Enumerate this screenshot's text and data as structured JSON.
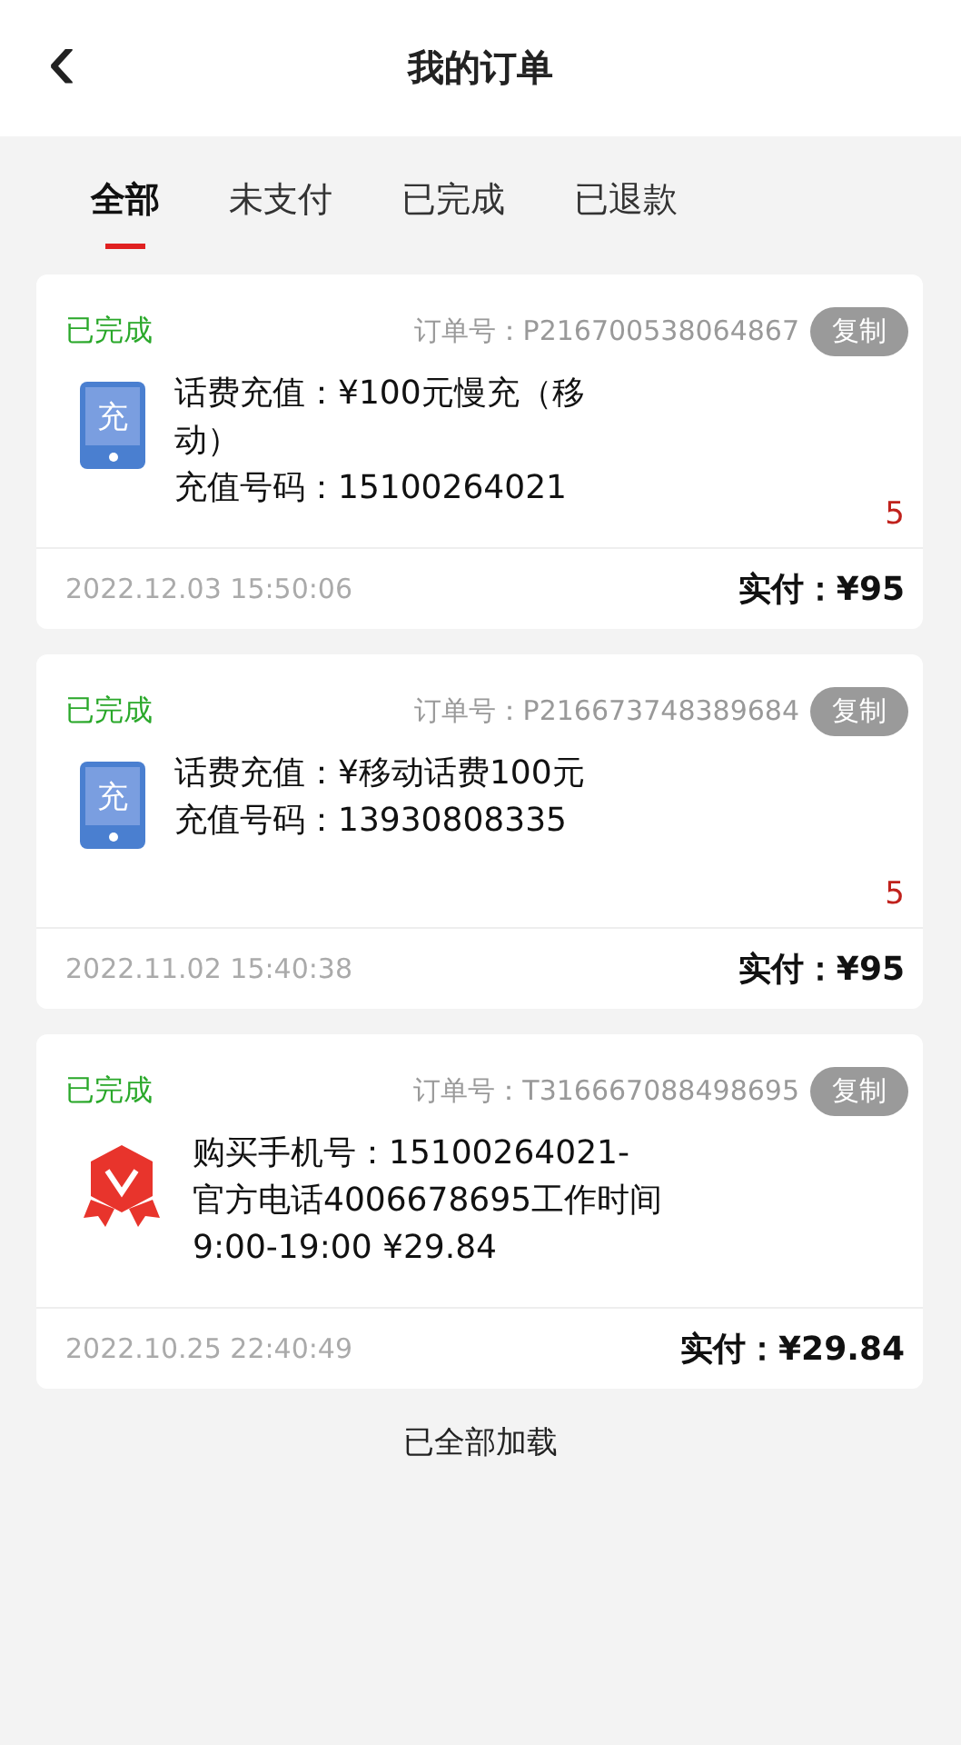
{
  "header": {
    "back": "‹",
    "title": "我的订单"
  },
  "tabs": [
    {
      "label": "全部",
      "selected": true
    },
    {
      "label": "未支付",
      "selected": false
    },
    {
      "label": "已完成",
      "selected": false
    },
    {
      "label": "已退款",
      "selected": false
    }
  ],
  "orders": [
    {
      "status": "已完成",
      "order_label": "订单号：",
      "order_no": "P216700538064867",
      "copy": "复制",
      "kind": "recharge",
      "icon_text": "充",
      "lines": [
        "话费充值：¥100元慢充（移",
        "动）",
        "充值号码：15100264021"
      ],
      "quantity": "5",
      "time": "2022.12.03 15:50:06",
      "paid": "实付：¥95"
    },
    {
      "status": "已完成",
      "order_label": "订单号：",
      "order_no": "P216673748389684",
      "copy": "复制",
      "kind": "recharge",
      "icon_text": "充",
      "lines": [
        "话费充值：¥移动话费100元",
        "充值号码：13930808335"
      ],
      "quantity": "5",
      "time": "2022.11.02 15:40:38",
      "paid": "实付：¥95"
    },
    {
      "status": "已完成",
      "order_label": "订单号：",
      "order_no": "T316667088498695",
      "copy": "复制",
      "kind": "badge",
      "lines": [
        "购买手机号：15100264021-",
        "官方电话4006678695工作时间",
        "9:00-19:00 ¥29.84"
      ],
      "time": "2022.10.25 22:40:49",
      "paid": "实付：¥29.84"
    }
  ],
  "footer": "已全部加载"
}
